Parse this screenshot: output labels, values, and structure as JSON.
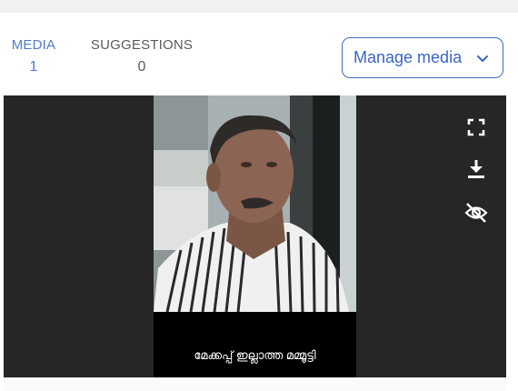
{
  "tabs": {
    "media": {
      "label": "MEDIA",
      "count": "1"
    },
    "suggestions": {
      "label": "SUGGESTIONS",
      "count": "0"
    }
  },
  "manage_media": {
    "label": "Manage media"
  },
  "viewer": {
    "caption": "മേക്കപ്പ് ഇല്ലാത്ത മമ്മൂട്ടി",
    "controls": {
      "fullscreen_icon": "fullscreen-icon",
      "download_icon": "download-icon",
      "hide_icon": "eye-off-icon"
    }
  },
  "colors": {
    "accent": "#4169c8",
    "tab_active": "#4f7ccf",
    "tab_inactive": "#5b5b5b",
    "viewer_bg": "#262626"
  }
}
